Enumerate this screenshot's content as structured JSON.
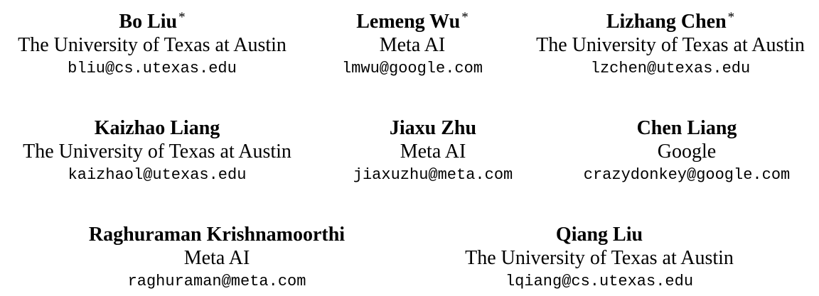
{
  "authors": [
    {
      "name": "Bo Liu",
      "mark": "*",
      "affiliation": "The University of Texas at Austin",
      "email": "bliu@cs.utexas.edu"
    },
    {
      "name": "Lemeng Wu",
      "mark": "*",
      "affiliation": "Meta AI",
      "email": "lmwu@google.com"
    },
    {
      "name": "Lizhang Chen",
      "mark": "*",
      "affiliation": "The University of Texas at Austin",
      "email": "lzchen@utexas.edu"
    },
    {
      "name": "Kaizhao Liang",
      "mark": "",
      "affiliation": "The University of Texas at Austin",
      "email": "kaizhaol@utexas.edu"
    },
    {
      "name": "Jiaxu Zhu",
      "mark": "",
      "affiliation": "Meta AI",
      "email": "jiaxuzhu@meta.com"
    },
    {
      "name": "Chen Liang",
      "mark": "",
      "affiliation": "Google",
      "email": "crazydonkey@google.com"
    },
    {
      "name": "Raghuraman Krishnamoorthi",
      "mark": "",
      "affiliation": "Meta AI",
      "email": "raghuraman@meta.com"
    },
    {
      "name": "Qiang Liu",
      "mark": "",
      "affiliation": "The University of Texas at Austin",
      "email": "lqiang@cs.utexas.edu"
    }
  ]
}
